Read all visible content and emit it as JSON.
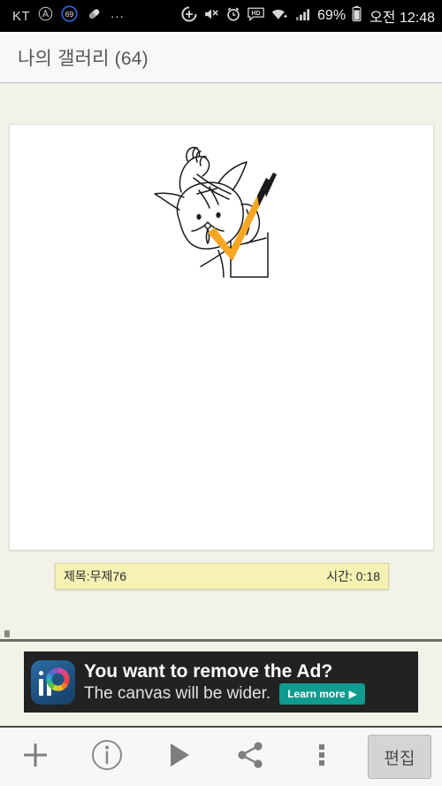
{
  "statusbar": {
    "carrier": "KT",
    "icons_left": [
      "circled-a-icon",
      "notification-count-badge",
      "pill-icon",
      "more-notifications-icon"
    ],
    "notification_count": "69",
    "overflow": "...",
    "icons_right": [
      "location-icon",
      "mute-icon",
      "alarm-icon",
      "hd-icon",
      "wifi-icon",
      "signal-icon",
      "battery-icon"
    ],
    "battery_percent": "69%",
    "clock": "오전 12:48"
  },
  "header": {
    "title": "나의 갤러리 (64)"
  },
  "gallery": {
    "canvas_label": "drawing-canvas",
    "caption": {
      "title": "제목:무제76",
      "time": "시간:  0:18"
    }
  },
  "ad": {
    "headline": "You want to remove the Ad?",
    "subline": "The canvas will be wider.",
    "cta_label": "Learn more",
    "cta_arrow": "▶",
    "icon_name": "ibis-paint-app-icon",
    "colors": {
      "background": "#222222",
      "cta": "#0f9b8e"
    }
  },
  "toolbar": {
    "buttons": [
      {
        "name": "add-button",
        "icon": "plus-icon"
      },
      {
        "name": "info-button",
        "icon": "info-circle-icon"
      },
      {
        "name": "play-button",
        "icon": "play-icon"
      },
      {
        "name": "share-button",
        "icon": "share-icon"
      },
      {
        "name": "overflow-button",
        "icon": "more-vertical-icon"
      }
    ],
    "edit_label": "편집"
  },
  "colors": {
    "page_background": "#f2f2e8",
    "caption_background": "#f6f1b4",
    "accent_orange": "#f5a623",
    "statusbar": "#000000"
  }
}
